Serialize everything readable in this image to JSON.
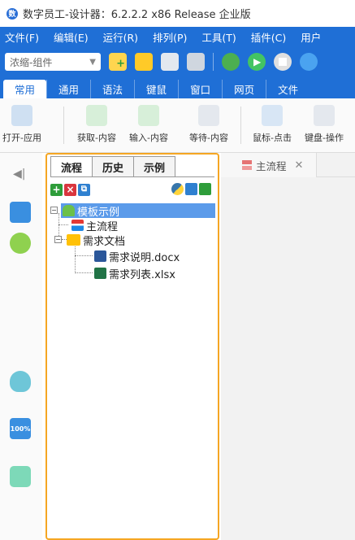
{
  "window": {
    "title": "数字员工-设计器：6.2.2.2 x86 Release 企业版",
    "app_icon": "数"
  },
  "menu": [
    "文件(F)",
    "编辑(E)",
    "运行(R)",
    "排列(P)",
    "工具(T)",
    "插件(C)",
    "用户"
  ],
  "toolbar": {
    "combo_value": "浓缩-组件"
  },
  "ribbon_tabs": [
    "常用",
    "通用",
    "语法",
    "键鼠",
    "窗口",
    "网页",
    "文件"
  ],
  "ribbon_buttons": [
    "打开-应用",
    "获取-内容",
    "输入-内容",
    "等待-内容",
    "鼠标-点击",
    "键盘-操作"
  ],
  "rail": {
    "collapse": "◀|",
    "zoom": "100%"
  },
  "panel": {
    "tabs": [
      "流程",
      "历史",
      "示例"
    ],
    "tools": {
      "add": "+",
      "remove": "×",
      "box": "⧉"
    }
  },
  "tree": {
    "root": "模板示例",
    "main_flow": "主流程",
    "folder": "需求文档",
    "doc1": "需求说明.docx",
    "doc2": "需求列表.xlsx"
  },
  "editor": {
    "tab_label": "主流程",
    "tab_close": "✕"
  },
  "colors": {
    "accent_blue": "#1f6fd6",
    "panel_border": "#f5a623",
    "selection": "#5b9bea"
  }
}
